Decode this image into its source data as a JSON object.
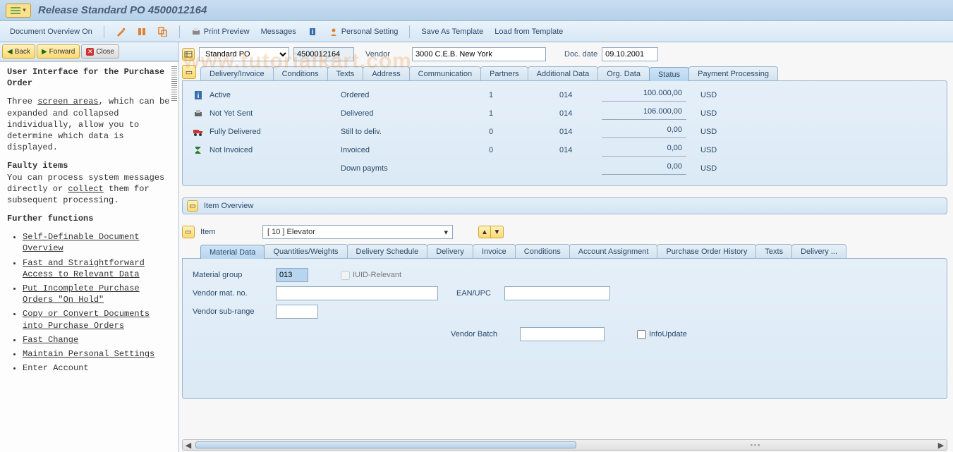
{
  "title": "Release Standard PO 4500012164",
  "watermark": "www.tutorialkart.com",
  "toolbar": {
    "doc_overview": "Document Overview On",
    "print_preview": "Print Preview",
    "messages": "Messages",
    "personal_setting": "Personal Setting",
    "save_template": "Save As Template",
    "load_template": "Load from Template"
  },
  "sidebar": {
    "back": "Back",
    "forward": "Forward",
    "close": "Close",
    "help": {
      "h1": "User Interface for the Purchase Order",
      "p1a": "Three ",
      "p1_link": "screen areas",
      "p1b": ", which can be expanded and collapsed individually, allow you to determine which data is displayed.",
      "h2": "Faulty items",
      "p2a": "You can process system messages directly or ",
      "p2_link": "collect",
      "p2b": " them for subsequent processing.",
      "h3": "Further functions",
      "items": [
        "Self-Definable Document Overview",
        "Fast and Straightforward Access to Relevant Data",
        "Put Incomplete Purchase Orders \"On Hold\"",
        "Copy or Convert Documents into Purchase Orders",
        "Fast Change",
        "Maintain Personal Settings",
        "Enter Account"
      ]
    }
  },
  "header": {
    "doc_type": "Standard PO",
    "po_number": "4500012164",
    "vendor_lbl": "Vendor",
    "vendor": "3000 C.E.B. New York",
    "docdate_lbl": "Doc. date",
    "docdate": "09.10.2001"
  },
  "header_tabs": [
    "Delivery/Invoice",
    "Conditions",
    "Texts",
    "Address",
    "Communication",
    "Partners",
    "Additional Data",
    "Org. Data",
    "Status",
    "Payment Processing"
  ],
  "header_active_tab": "Status",
  "status": {
    "left": [
      {
        "icon": "info",
        "label": "Active"
      },
      {
        "icon": "printer",
        "label": "Not Yet Sent"
      },
      {
        "icon": "truck",
        "label": "Fully Delivered"
      },
      {
        "icon": "sigma",
        "label": "Not Invoiced"
      }
    ],
    "rows": [
      {
        "label": "Ordered",
        "qty": "1",
        "unit": "014",
        "amt": "100.000,00",
        "cur": "USD"
      },
      {
        "label": "Delivered",
        "qty": "1",
        "unit": "014",
        "amt": "106.000,00",
        "cur": "USD"
      },
      {
        "label": "Still to deliv.",
        "qty": "0",
        "unit": "014",
        "amt": "0,00",
        "cur": "USD"
      },
      {
        "label": "Invoiced",
        "qty": "0",
        "unit": "014",
        "amt": "0,00",
        "cur": "USD"
      },
      {
        "label": "Down paymts",
        "qty": "",
        "unit": "",
        "amt": "0,00",
        "cur": "USD"
      }
    ]
  },
  "item_overview_label": "Item Overview",
  "item": {
    "lbl": "Item",
    "value": "[ 10 ] Elevator"
  },
  "item_tabs": [
    "Material Data",
    "Quantities/Weights",
    "Delivery Schedule",
    "Delivery",
    "Invoice",
    "Conditions",
    "Account Assignment",
    "Purchase Order History",
    "Texts",
    "Delivery ..."
  ],
  "item_active_tab": "Material Data",
  "material": {
    "matgrp_lbl": "Material group",
    "matgrp": "013",
    "iuid_lbl": "IUID-Relevant",
    "vendmat_lbl": "Vendor mat. no.",
    "vendmat": "",
    "ean_lbl": "EAN/UPC",
    "ean": "",
    "vsr_lbl": "Vendor sub-range",
    "vsr": "",
    "vbatch_lbl": "Vendor Batch",
    "vbatch": "",
    "infoupd_lbl": "InfoUpdate"
  }
}
